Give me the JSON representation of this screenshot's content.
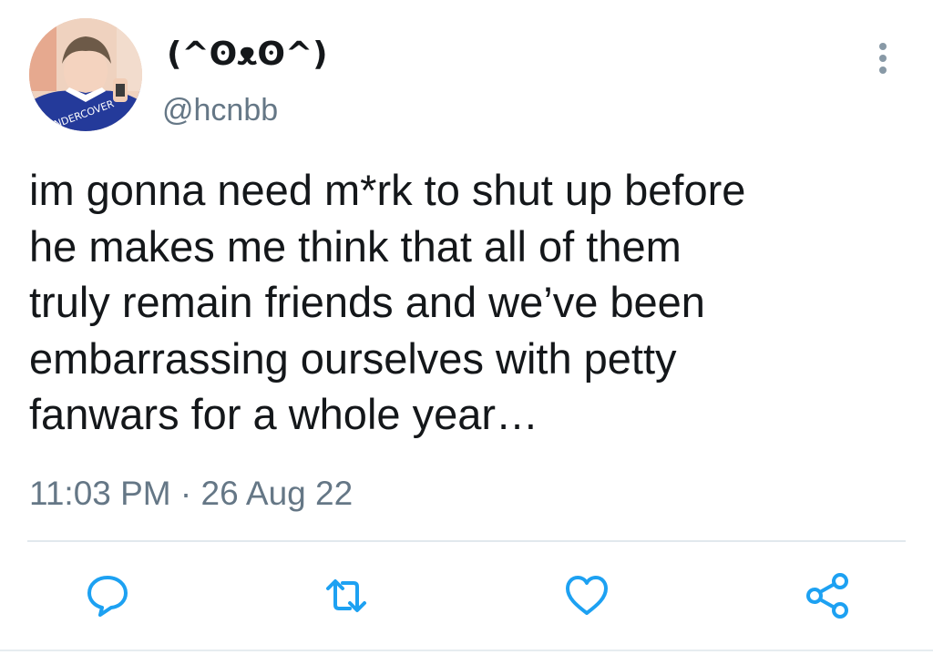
{
  "user": {
    "display_name": "(^ʘᴥʘ^)",
    "handle": "@hcnbb",
    "avatar_icon": "profile-photo"
  },
  "tweet": {
    "lines": [
      "im gonna need m*rk to shut up before",
      "he makes me think that all of them",
      "truly remain friends and we’ve been",
      "embarrassing ourselves with petty",
      "fanwars for a whole year…"
    ],
    "timestamp": "11:03 PM · 26 Aug 22"
  },
  "actions": {
    "reply_icon": "comment-icon",
    "retweet_icon": "retweet-icon",
    "like_icon": "heart-icon",
    "share_icon": "share-icon"
  },
  "colors": {
    "text": "#14171a",
    "secondary": "#657786",
    "icon": "#1da1f2"
  }
}
